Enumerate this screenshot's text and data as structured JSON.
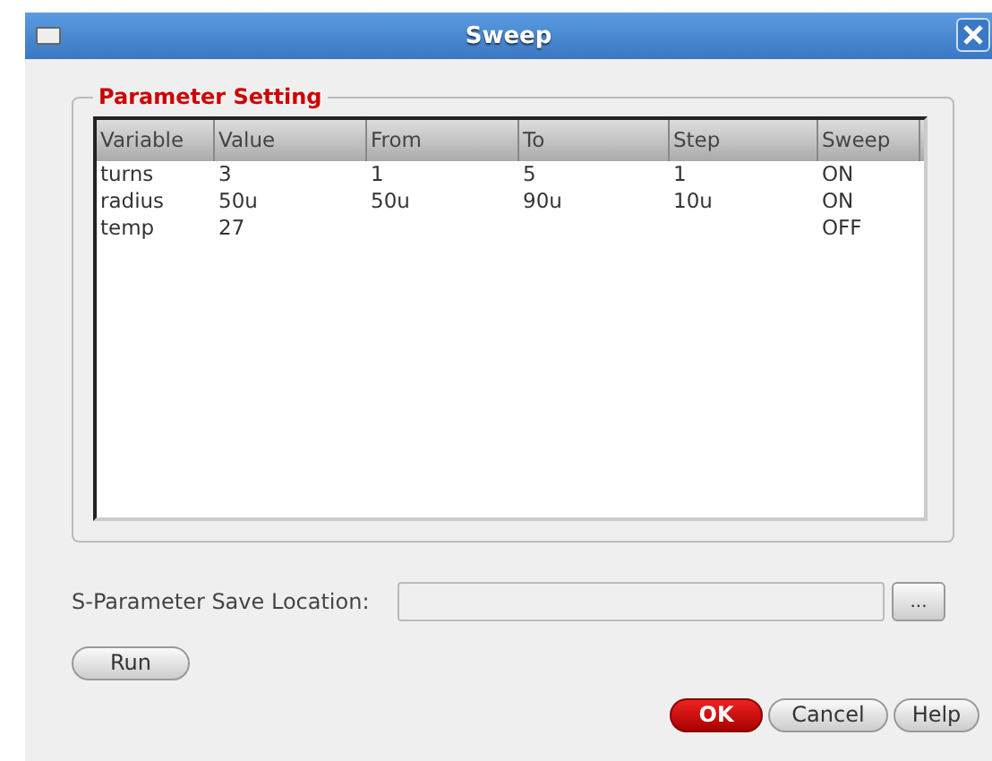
{
  "window": {
    "title": "Sweep"
  },
  "group": {
    "title": "Parameter Setting"
  },
  "table": {
    "columns": [
      "Variable",
      "Value",
      "From",
      "To",
      "Step",
      "Sweep"
    ],
    "rows": [
      [
        "turns",
        "3",
        "1",
        "5",
        "1",
        "ON"
      ],
      [
        "radius",
        "50u",
        "50u",
        "90u",
        "10u",
        "ON"
      ],
      [
        "temp",
        "27",
        "",
        "",
        "",
        "OFF"
      ]
    ]
  },
  "save_location": {
    "label": "S-Parameter Save Location:",
    "browse": "..."
  },
  "run_button": "Run",
  "buttons": [
    {
      "label": "OK",
      "default": true
    },
    {
      "label": "Cancel",
      "default": false
    },
    {
      "label": "Help",
      "default": false
    }
  ]
}
